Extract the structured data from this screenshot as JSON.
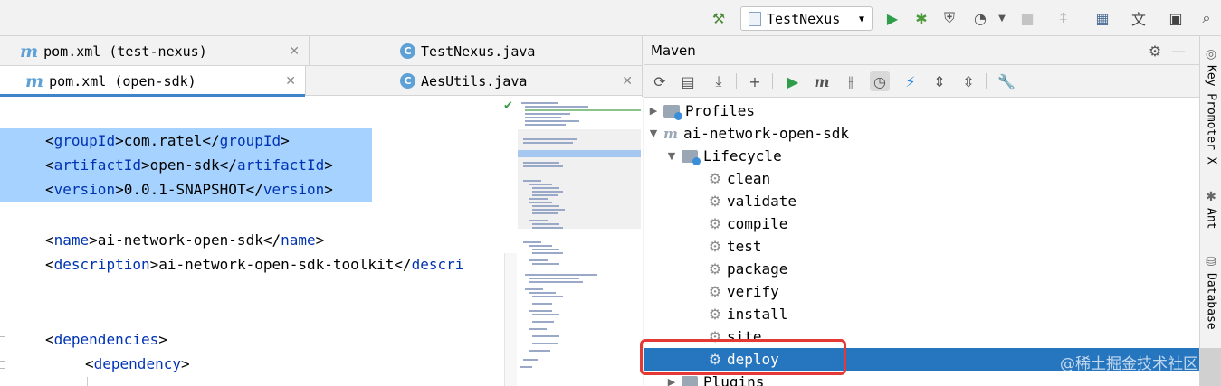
{
  "toolbar": {
    "run_config": "TestNexus",
    "colors": {
      "green": "#2e9e4b",
      "hammer": "#4f8a3c"
    }
  },
  "editor": {
    "tabs_row1": [
      {
        "label": "pom.xml (test-nexus)",
        "icon": "maven-icon"
      },
      {
        "label": "TestNexus.java",
        "icon": "class-icon"
      }
    ],
    "tabs_row2": [
      {
        "label": "pom.xml (open-sdk)",
        "icon": "maven-icon"
      },
      {
        "label": "AesUtils.java",
        "icon": "class-icon"
      }
    ],
    "code_lines": {
      "l1_open": "<",
      "l1_tag": "groupId",
      "l1_mid": ">com.ratel</",
      "l1_tag2": "groupId",
      "l1_close": ">",
      "l2_open": "<",
      "l2_tag": "artifactId",
      "l2_mid": ">open-sdk</",
      "l2_tag2": "artifactId",
      "l2_close": ">",
      "l3_open": "<",
      "l3_tag": "version",
      "l3_mid": ">0.0.1-SNAPSHOT</",
      "l3_tag2": "version",
      "l3_close": ">",
      "l4_open": "<",
      "l4_tag": "name",
      "l4_mid": ">ai-network-open-sdk</",
      "l4_tag2": "name",
      "l4_close": ">",
      "l5_open": "<",
      "l5_tag": "description",
      "l5_mid": ">ai-network-open-sdk-toolkit</",
      "l5_tag2": "descri",
      "l6_open": "<",
      "l6_tag": "dependencies",
      "l6_close": ">",
      "l7_open": "<",
      "l7_tag": "dependency",
      "l7_close": ">"
    }
  },
  "maven": {
    "title": "Maven",
    "tree": {
      "profiles": "Profiles",
      "project": "ai-network-open-sdk",
      "lifecycle": "Lifecycle",
      "goals": [
        "clean",
        "validate",
        "compile",
        "test",
        "package",
        "verify",
        "install",
        "site",
        "deploy"
      ],
      "plugins": "Plugins"
    },
    "selected_goal": "deploy",
    "colors": {
      "selected": "#2675bf",
      "highlight_box": "#e53935"
    }
  },
  "right_strip": {
    "items": [
      "Key Promoter X",
      "Ant",
      "Database"
    ]
  },
  "watermark": "@稀土掘金技术社区"
}
